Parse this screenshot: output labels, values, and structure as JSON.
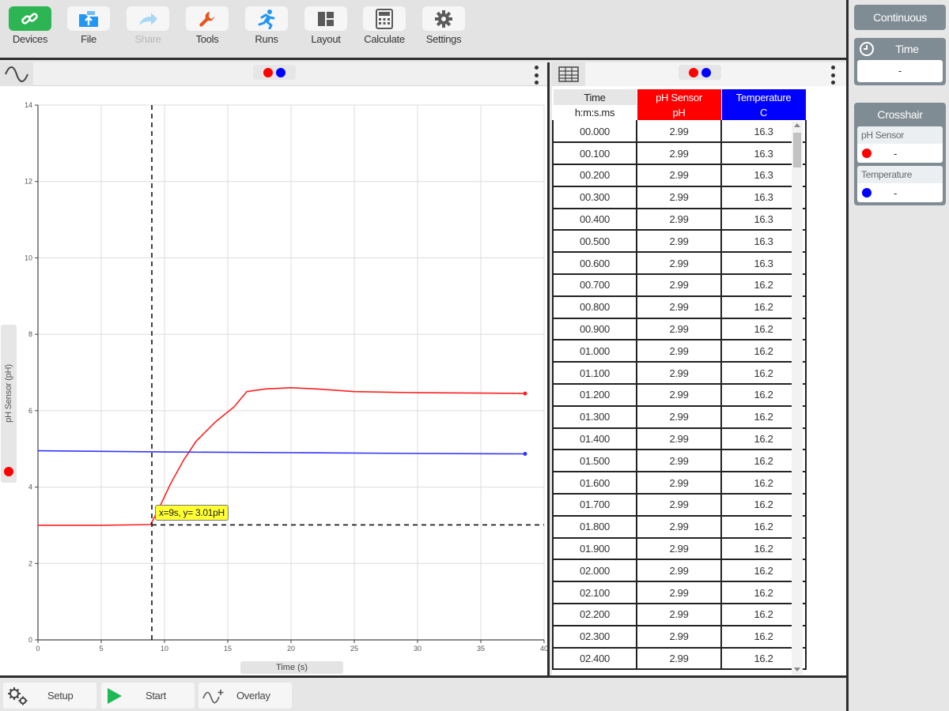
{
  "toolbar": {
    "devices": "Devices",
    "file": "File",
    "share": "Share",
    "tools": "Tools",
    "runs": "Runs",
    "layout": "Layout",
    "calculate": "Calculate",
    "settings": "Settings"
  },
  "sidebar": {
    "mode_button": "Continuous",
    "time_header": "Time",
    "time_value": "-",
    "crosshair_header": "Crosshair",
    "ph_title": "pH Sensor",
    "ph_value": "-",
    "temp_title": "Temperature",
    "temp_value": "-"
  },
  "graph": {
    "ylabel": "pH Sensor (pH)",
    "xlabel": "Time (s)",
    "tooltip": "x=9s, y= 3.01pH"
  },
  "chart_data": {
    "type": "line",
    "xlabel": "Time (s)",
    "ylabel": "pH Sensor (pH)",
    "xlim": [
      0,
      40
    ],
    "ylim": [
      0,
      14
    ],
    "x_ticks": [
      0,
      5,
      10,
      15,
      20,
      25,
      30,
      35,
      40
    ],
    "y_ticks": [
      0,
      2,
      4,
      6,
      8,
      10,
      12,
      14
    ],
    "grid": true,
    "series": [
      {
        "name": "pH Sensor",
        "color": "#ff2020",
        "x": [
          0,
          5,
          8.9,
          9.5,
          10.5,
          11.5,
          12.5,
          14,
          15.5,
          16.5,
          18,
          20,
          22,
          25,
          30,
          35,
          38.5
        ],
        "y": [
          3.0,
          3.0,
          3.02,
          3.4,
          4.1,
          4.7,
          5.2,
          5.7,
          6.1,
          6.5,
          6.57,
          6.6,
          6.57,
          6.5,
          6.47,
          6.46,
          6.45
        ]
      },
      {
        "name": "Temperature",
        "color": "#3333ff",
        "x": [
          0,
          10,
          20,
          30,
          38.5
        ],
        "y": [
          4.95,
          4.92,
          4.9,
          4.88,
          4.87
        ]
      }
    ],
    "crosshair": {
      "x": 9,
      "y": 3.01
    }
  },
  "table": {
    "columns": [
      {
        "line1": "Time",
        "line2": "h:m:s.ms",
        "color": "#e6e6e6",
        "text_color": "#222"
      },
      {
        "line1": "pH Sensor",
        "line2": "pH",
        "color": "#ff0000",
        "text_color": "#ffffff"
      },
      {
        "line1": "Temperature",
        "line2": "C",
        "color": "#0000ff",
        "text_color": "#ffffff"
      }
    ],
    "rows": [
      [
        "00.000",
        "2.99",
        "16.3"
      ],
      [
        "00.100",
        "2.99",
        "16.3"
      ],
      [
        "00.200",
        "2.99",
        "16.3"
      ],
      [
        "00.300",
        "2.99",
        "16.3"
      ],
      [
        "00.400",
        "2.99",
        "16.3"
      ],
      [
        "00.500",
        "2.99",
        "16.3"
      ],
      [
        "00.600",
        "2.99",
        "16.3"
      ],
      [
        "00.700",
        "2.99",
        "16.2"
      ],
      [
        "00.800",
        "2.99",
        "16.2"
      ],
      [
        "00.900",
        "2.99",
        "16.2"
      ],
      [
        "01.000",
        "2.99",
        "16.2"
      ],
      [
        "01.100",
        "2.99",
        "16.2"
      ],
      [
        "01.200",
        "2.99",
        "16.2"
      ],
      [
        "01.300",
        "2.99",
        "16.2"
      ],
      [
        "01.400",
        "2.99",
        "16.2"
      ],
      [
        "01.500",
        "2.99",
        "16.2"
      ],
      [
        "01.600",
        "2.99",
        "16.2"
      ],
      [
        "01.700",
        "2.99",
        "16.2"
      ],
      [
        "01.800",
        "2.99",
        "16.2"
      ],
      [
        "01.900",
        "2.99",
        "16.2"
      ],
      [
        "02.000",
        "2.99",
        "16.2"
      ],
      [
        "02.100",
        "2.99",
        "16.2"
      ],
      [
        "02.200",
        "2.99",
        "16.2"
      ],
      [
        "02.300",
        "2.99",
        "16.2"
      ],
      [
        "02.400",
        "2.99",
        "16.2"
      ]
    ]
  },
  "bottom": {
    "setup": "Setup",
    "start": "Start",
    "overlay": "Overlay"
  },
  "colors": {
    "ph": "#ff0000",
    "temperature": "#0000ff",
    "devices_green": "#2db553",
    "file_blue": "#2196f3",
    "tools_orange": "#e8531c",
    "start_green": "#1db954"
  },
  "icons": [
    "link-icon",
    "folder-upload-icon",
    "share-arrow-icon",
    "wrench-icon",
    "runner-icon",
    "layout-grid-icon",
    "calculator-icon",
    "gear-icon",
    "clock-icon",
    "table-icon",
    "sine-wave-icon",
    "play-icon",
    "overlay-icon"
  ]
}
